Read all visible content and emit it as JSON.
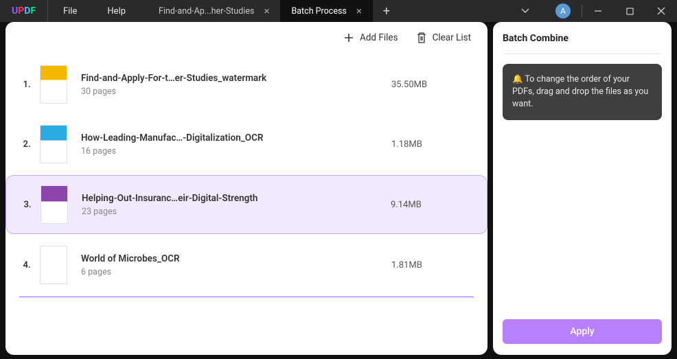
{
  "app": {
    "logo": {
      "u": "U",
      "p": "P",
      "d": "D",
      "f": "F"
    }
  },
  "menu": {
    "file": "File",
    "help": "Help"
  },
  "tabs": [
    {
      "label": "Find-and-Ap...her-Studies",
      "active": false
    },
    {
      "label": "Batch Process",
      "active": true
    }
  ],
  "avatar": "A",
  "toolbar": {
    "add_files": "Add Files",
    "clear_list": "Clear List"
  },
  "files": [
    {
      "index": "1.",
      "name": "Find-and-Apply-For-t…er-Studies_watermark",
      "pages": "30 pages",
      "size": "35.50MB",
      "selected": false,
      "thumb": "thumb1"
    },
    {
      "index": "2.",
      "name": "How-Leading-Manufac…-Digitalization_OCR",
      "pages": "16 pages",
      "size": "1.18MB",
      "selected": false,
      "thumb": "thumb2"
    },
    {
      "index": "3.",
      "name": "Helping-Out-Insuranc…eir-Digital-Strength",
      "pages": "23 pages",
      "size": "9.14MB",
      "selected": true,
      "thumb": "thumb3"
    },
    {
      "index": "4.",
      "name": "World of Microbes_OCR",
      "pages": "6 pages",
      "size": "1.81MB",
      "selected": false,
      "thumb": "thumb4"
    }
  ],
  "side": {
    "title": "Batch Combine",
    "info": "To change the order of your PDFs, drag and drop the files as you want.",
    "apply": "Apply"
  }
}
